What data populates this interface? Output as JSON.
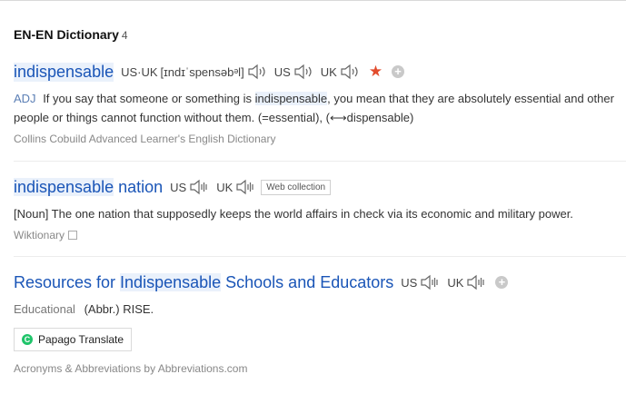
{
  "section": {
    "title": "EN-EN Dictionary",
    "count": "4"
  },
  "entries": [
    {
      "headword": "indispensable",
      "pron_label": "US·UK",
      "phonetic": "[ɪndɪˈspensəbᵊl]",
      "us_label": "US",
      "uk_label": "UK",
      "pos": "ADJ",
      "def_before": "If you say that someone or something is ",
      "def_highlight": "indispensable",
      "def_after": ", you mean that they are absolutely essential and other people or things cannot function without them. (=essential), (⟷dispensable)",
      "source": "Collins Cobuild Advanced Learner's English Dictionary"
    },
    {
      "headword_hl": "indispensable",
      "headword_rest": " nation",
      "us_label": "US",
      "uk_label": "UK",
      "tag": "Web collection",
      "definition": "[Noun] The one nation that supposedly keeps the world affairs in check via its economic and military power.",
      "source": "Wiktionary"
    },
    {
      "headword_a": "Resources for ",
      "headword_hl": "Indispensable",
      "headword_b": " Schools and Educators",
      "us_label": "US",
      "uk_label": "UK",
      "category": "Educational",
      "definition": "(Abbr.) RISE.",
      "translate_label": "Papago Translate",
      "source": "Acronyms & Abbreviations by Abbreviations.com"
    }
  ],
  "colors": {
    "link": "#1a55b7",
    "star": "#e24c2d",
    "highlight": "#eaf1fb"
  },
  "icons": {
    "speaker": "speaker-icon",
    "star": "star-icon",
    "add": "plus-icon",
    "copy": "copy-icon",
    "papago": "papago-logo-icon"
  }
}
